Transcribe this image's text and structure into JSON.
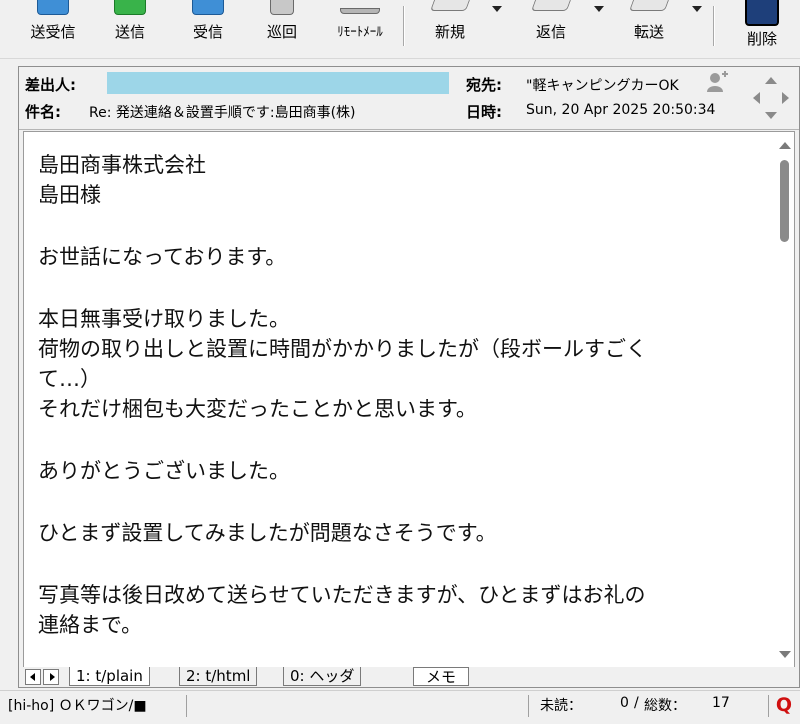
{
  "toolbar": {
    "buttons": [
      {
        "label": "送受信",
        "icon": "send-receive-icon"
      },
      {
        "label": "送信",
        "icon": "send-icon"
      },
      {
        "label": "受信",
        "icon": "receive-icon"
      },
      {
        "label": "巡回",
        "icon": "patrol-icon"
      },
      {
        "label": "ﾘﾓｰﾄﾒｰﾙ",
        "icon": "remote-mail-icon"
      },
      {
        "label": "新規",
        "icon": "new-mail-icon"
      },
      {
        "label": "返信",
        "icon": "reply-icon"
      },
      {
        "label": "転送",
        "icon": "forward-icon"
      },
      {
        "label": "削除",
        "icon": "delete-icon"
      }
    ]
  },
  "header": {
    "from_key": "差出人:",
    "from_value": "",
    "to_key": "宛先:",
    "to_value": "\"軽キャンピングカーOK",
    "subject_key": "件名:",
    "subject_value": "Re: 発送連絡＆設置手順です:島田商事(株)",
    "date_key": "日時:",
    "date_value": "Sun, 20 Apr 2025 20:50:34"
  },
  "body": {
    "lines": [
      "島田商事株式会社",
      "島田様",
      "",
      "お世話になっております。",
      "",
      "本日無事受け取りました。",
      "荷物の取り出しと設置に時間がかかりましたが（段ボールすごく",
      "て…）",
      "それだけ梱包も大変だったことかと思います。",
      "",
      "ありがとうございました。",
      "",
      "ひとまず設置してみましたが問題なさそうです。",
      "",
      "写真等は後日改めて送らせていただきますが、ひとまずはお礼の",
      "連絡まで。"
    ]
  },
  "tabs": {
    "items": [
      "1: t/plain",
      "2: t/html",
      "0: ヘッダ"
    ],
    "memo": "メモ"
  },
  "status": {
    "mailbox": "[hi-ho] ＯＫワゴン/■",
    "unread_label": "未読：",
    "unread_value": "0",
    "total_label": "総数：",
    "total_value": "17",
    "app_icon": "Q"
  },
  "colors": {
    "sender_highlight": "#9dd6e8",
    "app_icon": "#d01010"
  }
}
